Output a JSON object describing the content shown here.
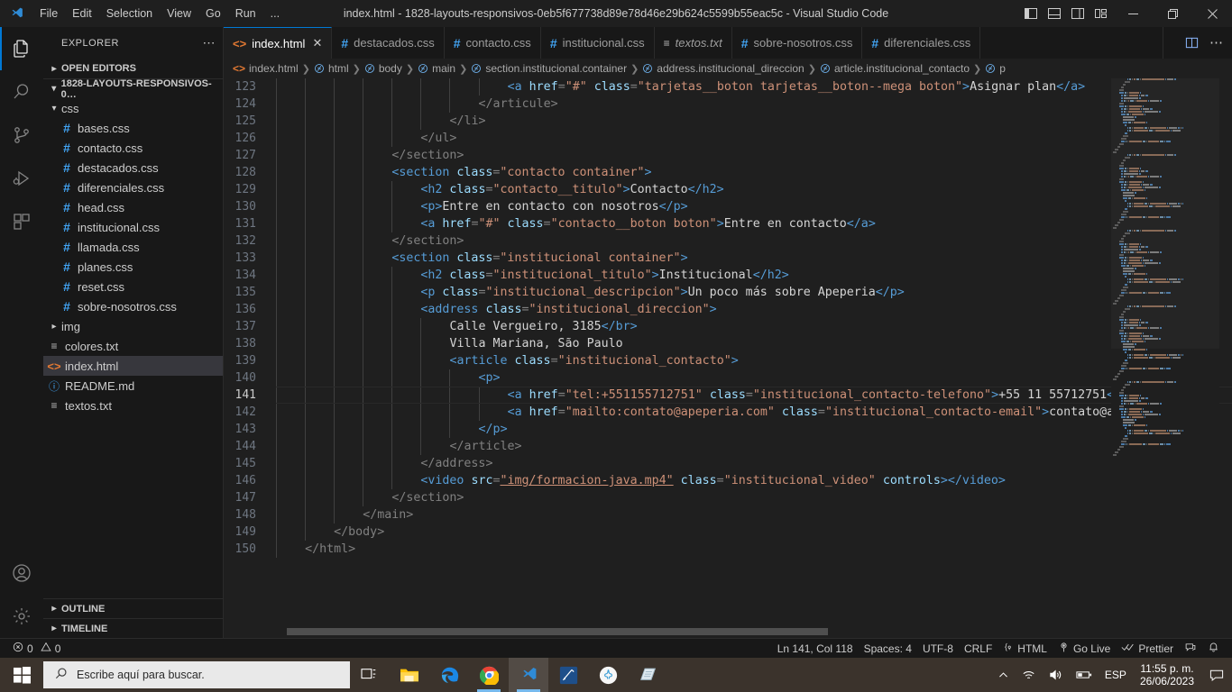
{
  "window": {
    "title": "index.html - 1828-layouts-responsivos-0eb5f677738d89e78d46e29b624c5599b55eac5c - Visual Studio Code",
    "menus": [
      "File",
      "Edit",
      "Selection",
      "View",
      "Go",
      "Run",
      "..."
    ],
    "layout_buttons": [
      "toggle-primary-sidebar",
      "toggle-panel",
      "toggle-secondary-sidebar",
      "customize-layout"
    ],
    "controls": {
      "minimize": "—",
      "maximize": "❐",
      "close": "✕"
    }
  },
  "activitybar": {
    "items": [
      {
        "name": "explorer",
        "icon": "files-icon",
        "active": true
      },
      {
        "name": "search",
        "icon": "search-icon",
        "active": false
      },
      {
        "name": "source-control",
        "icon": "source-control-icon",
        "active": false
      },
      {
        "name": "run-debug",
        "icon": "run-debug-icon",
        "active": false
      },
      {
        "name": "extensions",
        "icon": "extensions-icon",
        "active": false
      }
    ],
    "bottom": [
      {
        "name": "accounts",
        "icon": "account-icon"
      },
      {
        "name": "settings",
        "icon": "gear-icon"
      }
    ]
  },
  "sidebar": {
    "header": "EXPLORER",
    "more_actions": "⋯",
    "open_editors": {
      "label": "OPEN EDITORS",
      "expanded": false
    },
    "project": {
      "label": "1828-LAYOUTS-RESPONSIVOS-0…",
      "expanded": true
    },
    "tree": [
      {
        "label": "css",
        "type": "folder",
        "expanded": true,
        "depth": 1
      },
      {
        "label": "bases.css",
        "type": "css",
        "depth": 2
      },
      {
        "label": "contacto.css",
        "type": "css",
        "depth": 2
      },
      {
        "label": "destacados.css",
        "type": "css",
        "depth": 2
      },
      {
        "label": "diferenciales.css",
        "type": "css",
        "depth": 2
      },
      {
        "label": "head.css",
        "type": "css",
        "depth": 2
      },
      {
        "label": "institucional.css",
        "type": "css",
        "depth": 2
      },
      {
        "label": "llamada.css",
        "type": "css",
        "depth": 2
      },
      {
        "label": "planes.css",
        "type": "css",
        "depth": 2
      },
      {
        "label": "reset.css",
        "type": "css",
        "depth": 2
      },
      {
        "label": "sobre-nosotros.css",
        "type": "css",
        "depth": 2
      },
      {
        "label": "img",
        "type": "folder",
        "expanded": false,
        "depth": 1
      },
      {
        "label": "colores.txt",
        "type": "txt",
        "depth": 1
      },
      {
        "label": "index.html",
        "type": "html",
        "depth": 1,
        "selected": true
      },
      {
        "label": "README.md",
        "type": "md",
        "depth": 1
      },
      {
        "label": "textos.txt",
        "type": "txt",
        "depth": 1
      }
    ],
    "footer": [
      {
        "label": "OUTLINE",
        "expanded": false
      },
      {
        "label": "TIMELINE",
        "expanded": false
      }
    ]
  },
  "tabs": [
    {
      "label": "index.html",
      "icon": "html-icon",
      "active": true,
      "closable": true,
      "italic": false
    },
    {
      "label": "destacados.css",
      "icon": "css-icon",
      "active": false,
      "closable": false,
      "italic": false
    },
    {
      "label": "contacto.css",
      "icon": "css-icon",
      "active": false,
      "closable": false,
      "italic": false
    },
    {
      "label": "institucional.css",
      "icon": "css-icon",
      "active": false,
      "closable": false,
      "italic": false
    },
    {
      "label": "textos.txt",
      "icon": "txt-icon",
      "active": false,
      "closable": false,
      "italic": true
    },
    {
      "label": "sobre-nosotros.css",
      "icon": "css-icon",
      "active": false,
      "closable": false,
      "italic": false
    },
    {
      "label": "diferenciales.css",
      "icon": "css-icon",
      "active": false,
      "closable": false,
      "italic": false
    }
  ],
  "tab_actions": [
    "split-editor",
    "more-actions"
  ],
  "breadcrumbs": [
    {
      "label": "index.html",
      "icon": "html-icon"
    },
    {
      "label": "html",
      "icon": "symbol-icon"
    },
    {
      "label": "body",
      "icon": "symbol-icon"
    },
    {
      "label": "main",
      "icon": "symbol-icon"
    },
    {
      "label": "section.institucional.container",
      "icon": "symbol-icon"
    },
    {
      "label": "address.institucional_direccion",
      "icon": "symbol-icon"
    },
    {
      "label": "article.institucional_contacto",
      "icon": "symbol-icon"
    },
    {
      "label": "p",
      "icon": "symbol-icon"
    }
  ],
  "code": {
    "first_line": 123,
    "current_line": 141,
    "lines": [
      {
        "n": 123,
        "indent": 8,
        "tokens": [
          {
            "t": "<a ",
            "c": "t-tag"
          },
          {
            "t": "href",
            "c": "t-attr"
          },
          {
            "t": "=",
            "c": "t-punct"
          },
          {
            "t": "\"#\"",
            "c": "t-str"
          },
          {
            "t": " class",
            "c": "t-attr"
          },
          {
            "t": "=",
            "c": "t-punct"
          },
          {
            "t": "\"tarjetas__boton tarjetas__boton--mega boton\"",
            "c": "t-str"
          },
          {
            "t": ">",
            "c": "t-tag"
          },
          {
            "t": "Asignar plan",
            "c": "t-text"
          },
          {
            "t": "</a>",
            "c": "t-tag"
          }
        ]
      },
      {
        "n": 124,
        "indent": 7,
        "tokens": [
          {
            "t": "</articule>",
            "c": "t-punct"
          }
        ]
      },
      {
        "n": 125,
        "indent": 6,
        "tokens": [
          {
            "t": "</li>",
            "c": "t-punct"
          }
        ]
      },
      {
        "n": 126,
        "indent": 5,
        "tokens": [
          {
            "t": "</ul>",
            "c": "t-punct"
          }
        ]
      },
      {
        "n": 127,
        "indent": 4,
        "tokens": [
          {
            "t": "</section>",
            "c": "t-punct"
          }
        ]
      },
      {
        "n": 128,
        "indent": 4,
        "tokens": [
          {
            "t": "<section ",
            "c": "t-tag"
          },
          {
            "t": "class",
            "c": "t-attr"
          },
          {
            "t": "=",
            "c": "t-punct"
          },
          {
            "t": "\"contacto container\"",
            "c": "t-str"
          },
          {
            "t": ">",
            "c": "t-tag"
          }
        ]
      },
      {
        "n": 129,
        "indent": 5,
        "tokens": [
          {
            "t": "<h2 ",
            "c": "t-tag"
          },
          {
            "t": "class",
            "c": "t-attr"
          },
          {
            "t": "=",
            "c": "t-punct"
          },
          {
            "t": "\"contacto__titulo\"",
            "c": "t-str"
          },
          {
            "t": ">",
            "c": "t-tag"
          },
          {
            "t": "Contacto",
            "c": "t-text"
          },
          {
            "t": "</h2>",
            "c": "t-tag"
          }
        ]
      },
      {
        "n": 130,
        "indent": 5,
        "tokens": [
          {
            "t": "<p>",
            "c": "t-tag"
          },
          {
            "t": "Entre en contacto con nosotros",
            "c": "t-text"
          },
          {
            "t": "</p>",
            "c": "t-tag"
          }
        ]
      },
      {
        "n": 131,
        "indent": 5,
        "tokens": [
          {
            "t": "<a ",
            "c": "t-tag"
          },
          {
            "t": "href",
            "c": "t-attr"
          },
          {
            "t": "=",
            "c": "t-punct"
          },
          {
            "t": "\"#\"",
            "c": "t-str"
          },
          {
            "t": " class",
            "c": "t-attr"
          },
          {
            "t": "=",
            "c": "t-punct"
          },
          {
            "t": "\"contacto__boton boton\"",
            "c": "t-str"
          },
          {
            "t": ">",
            "c": "t-tag"
          },
          {
            "t": "Entre en contacto",
            "c": "t-text"
          },
          {
            "t": "</a>",
            "c": "t-tag"
          }
        ]
      },
      {
        "n": 132,
        "indent": 4,
        "tokens": [
          {
            "t": "</section>",
            "c": "t-punct"
          }
        ]
      },
      {
        "n": 133,
        "indent": 4,
        "tokens": [
          {
            "t": "<section ",
            "c": "t-tag"
          },
          {
            "t": "class",
            "c": "t-attr"
          },
          {
            "t": "=",
            "c": "t-punct"
          },
          {
            "t": "\"institucional container\"",
            "c": "t-str"
          },
          {
            "t": ">",
            "c": "t-tag"
          }
        ]
      },
      {
        "n": 134,
        "indent": 5,
        "tokens": [
          {
            "t": "<h2 ",
            "c": "t-tag"
          },
          {
            "t": "class",
            "c": "t-attr"
          },
          {
            "t": "=",
            "c": "t-punct"
          },
          {
            "t": "\"institucional_titulo\"",
            "c": "t-str"
          },
          {
            "t": ">",
            "c": "t-tag"
          },
          {
            "t": "Institucional",
            "c": "t-text"
          },
          {
            "t": "</h2>",
            "c": "t-tag"
          }
        ]
      },
      {
        "n": 135,
        "indent": 5,
        "tokens": [
          {
            "t": "<p ",
            "c": "t-tag"
          },
          {
            "t": "class",
            "c": "t-attr"
          },
          {
            "t": "=",
            "c": "t-punct"
          },
          {
            "t": "\"institucional_descripcion\"",
            "c": "t-str"
          },
          {
            "t": ">",
            "c": "t-tag"
          },
          {
            "t": "Un poco más sobre Apeperia",
            "c": "t-text"
          },
          {
            "t": "</p>",
            "c": "t-tag"
          }
        ]
      },
      {
        "n": 136,
        "indent": 5,
        "tokens": [
          {
            "t": "<address ",
            "c": "t-tag"
          },
          {
            "t": "class",
            "c": "t-attr"
          },
          {
            "t": "=",
            "c": "t-punct"
          },
          {
            "t": "\"institucional_direccion\"",
            "c": "t-str"
          },
          {
            "t": ">",
            "c": "t-tag"
          }
        ]
      },
      {
        "n": 137,
        "indent": 6,
        "tokens": [
          {
            "t": "Calle Vergueiro, 3185",
            "c": "t-text"
          },
          {
            "t": "</br>",
            "c": "t-tag"
          }
        ]
      },
      {
        "n": 138,
        "indent": 6,
        "tokens": [
          {
            "t": "Villa Mariana, São Paulo",
            "c": "t-text"
          }
        ]
      },
      {
        "n": 139,
        "indent": 6,
        "tokens": [
          {
            "t": "<article ",
            "c": "t-tag"
          },
          {
            "t": "class",
            "c": "t-attr"
          },
          {
            "t": "=",
            "c": "t-punct"
          },
          {
            "t": "\"institucional_contacto\"",
            "c": "t-str"
          },
          {
            "t": ">",
            "c": "t-tag"
          }
        ]
      },
      {
        "n": 140,
        "indent": 7,
        "tokens": [
          {
            "t": "<p>",
            "c": "t-tag"
          }
        ]
      },
      {
        "n": 141,
        "indent": 8,
        "tokens": [
          {
            "t": "<a ",
            "c": "t-tag"
          },
          {
            "t": "href",
            "c": "t-attr"
          },
          {
            "t": "=",
            "c": "t-punct"
          },
          {
            "t": "\"tel:+551155712751\"",
            "c": "t-str"
          },
          {
            "t": " class",
            "c": "t-attr"
          },
          {
            "t": "=",
            "c": "t-punct"
          },
          {
            "t": "\"institucional_contacto-telefono\"",
            "c": "t-str"
          },
          {
            "t": ">",
            "c": "t-tag"
          },
          {
            "t": "+55 11 55712751",
            "c": "t-text"
          },
          {
            "t": "</a>",
            "c": "t-tag"
          },
          {
            "t": "  ",
            "c": "t-text"
          },
          {
            "t": "CURSOR",
            "c": "cursor"
          },
          {
            "t": "p",
            "c": "t-tag"
          }
        ]
      },
      {
        "n": 142,
        "indent": 8,
        "tokens": [
          {
            "t": "<a ",
            "c": "t-tag"
          },
          {
            "t": "href",
            "c": "t-attr"
          },
          {
            "t": "=",
            "c": "t-punct"
          },
          {
            "t": "\"mailto:contato@apeperia.com\"",
            "c": "t-str"
          },
          {
            "t": " class",
            "c": "t-attr"
          },
          {
            "t": "=",
            "c": "t-punct"
          },
          {
            "t": "\"institucional_contacto-email\"",
            "c": "t-str"
          },
          {
            "t": ">",
            "c": "t-tag"
          },
          {
            "t": "contato@apeperia",
            "c": "t-text"
          }
        ]
      },
      {
        "n": 143,
        "indent": 7,
        "tokens": [
          {
            "t": "</p>",
            "c": "t-tag"
          }
        ]
      },
      {
        "n": 144,
        "indent": 6,
        "tokens": [
          {
            "t": "</article>",
            "c": "t-punct"
          }
        ]
      },
      {
        "n": 145,
        "indent": 5,
        "tokens": [
          {
            "t": "</address>",
            "c": "t-punct"
          }
        ]
      },
      {
        "n": 146,
        "indent": 5,
        "tokens": [
          {
            "t": "<video ",
            "c": "t-tag"
          },
          {
            "t": "src",
            "c": "t-attr"
          },
          {
            "t": "=",
            "c": "t-punct"
          },
          {
            "t": "\"img/formacion-java.mp4\"",
            "c": "t-link"
          },
          {
            "t": " class",
            "c": "t-attr"
          },
          {
            "t": "=",
            "c": "t-punct"
          },
          {
            "t": "\"institucional_video\"",
            "c": "t-str"
          },
          {
            "t": " controls",
            "c": "t-attr"
          },
          {
            "t": ">",
            "c": "t-tag"
          },
          {
            "t": "</video>",
            "c": "t-tag"
          }
        ]
      },
      {
        "n": 147,
        "indent": 4,
        "tokens": [
          {
            "t": "</section>",
            "c": "t-punct"
          }
        ]
      },
      {
        "n": 148,
        "indent": 3,
        "tokens": [
          {
            "t": "</main>",
            "c": "t-punct"
          }
        ]
      },
      {
        "n": 149,
        "indent": 2,
        "tokens": [
          {
            "t": "</body>",
            "c": "t-punct"
          }
        ]
      },
      {
        "n": 150,
        "indent": 1,
        "tokens": [
          {
            "t": "</html>",
            "c": "t-punct"
          }
        ]
      }
    ]
  },
  "statusbar": {
    "errors": "0",
    "warnings": "0",
    "position": "Ln 141, Col 118",
    "spaces": "Spaces: 4",
    "encoding": "UTF-8",
    "eol": "CRLF",
    "language": "HTML",
    "golive": "Go Live",
    "prettier": "Prettier",
    "remote_icon": "remote-icon",
    "bell_icon": "bell-icon"
  },
  "taskbar": {
    "start": "start-icon",
    "search_placeholder": "Escribe aquí para buscar.",
    "apps": [
      {
        "name": "task-view-icon",
        "running": false,
        "active": false
      },
      {
        "name": "file-explorer-icon",
        "running": false,
        "active": false
      },
      {
        "name": "microsoft-edge-icon",
        "running": false,
        "active": false
      },
      {
        "name": "google-chrome-icon",
        "running": true,
        "active": false
      },
      {
        "name": "vscode-icon",
        "running": true,
        "active": true
      },
      {
        "name": "blue-app-icon",
        "running": false,
        "active": false
      },
      {
        "name": "coral-app-icon",
        "running": false,
        "active": false
      },
      {
        "name": "notepad-icon",
        "running": false,
        "active": false
      }
    ],
    "tray": [
      "chevron-up-icon",
      "wifi-icon",
      "volume-icon",
      "battery-icon"
    ],
    "language": "ESP",
    "time": "11:55 p. m.",
    "date": "26/06/2023",
    "action_center": "action-center-icon"
  },
  "colors": {
    "accent": "#0078d4",
    "editor_bg": "#1f1f1f",
    "sidebar_bg": "#181818",
    "taskbar_bg": "#3b332c"
  }
}
